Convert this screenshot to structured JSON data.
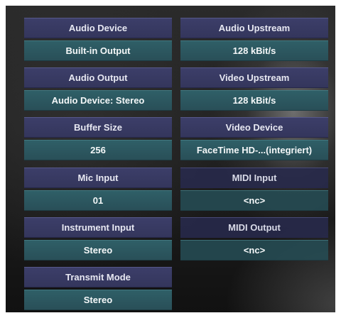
{
  "left_column": [
    {
      "label": "Audio Device",
      "value": "Built-in Output"
    },
    {
      "label": "Audio Output",
      "value": "Audio Device:  Stereo"
    },
    {
      "label": "Buffer Size",
      "value": "256"
    },
    {
      "label": "Mic Input",
      "value": "01"
    },
    {
      "label": "Instrument Input",
      "value": "Stereo"
    },
    {
      "label": "Transmit Mode",
      "value": "Stereo"
    }
  ],
  "right_column": [
    {
      "label": "Audio Upstream",
      "value": "128 kBit/s"
    },
    {
      "label": "Video Upstream",
      "value": "128 kBit/s"
    },
    {
      "label": "Video Device",
      "value": "FaceTime HD-...(integriert)"
    },
    {
      "label": "MIDI Input",
      "value": "<nc>"
    },
    {
      "label": "MIDI Output",
      "value": "<nc>"
    }
  ]
}
